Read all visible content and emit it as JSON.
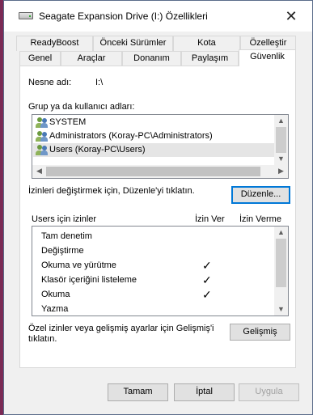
{
  "window": {
    "title": "Seagate Expansion Drive (I:) Özellikleri",
    "close_glyph": "✕"
  },
  "tabs_row1": [
    {
      "label": "ReadyBoost"
    },
    {
      "label": "Önceki Sürümler"
    },
    {
      "label": "Kota"
    },
    {
      "label": "Özelleştir"
    }
  ],
  "tabs_row2": [
    {
      "label": "Genel"
    },
    {
      "label": "Araçlar"
    },
    {
      "label": "Donanım"
    },
    {
      "label": "Paylaşım"
    },
    {
      "label": "Güvenlik"
    }
  ],
  "security": {
    "object_label": "Nesne adı:",
    "object_value": "I:\\",
    "group_label": "Grup ya da kullanıcı adları:",
    "users": [
      {
        "name": "SYSTEM"
      },
      {
        "name": "Administrators (Koray-PC\\Administrators)"
      },
      {
        "name": "Users (Koray-PC\\Users)"
      }
    ],
    "change_hint": "İzinleri değiştirmek için, Düzenle'yi tıklatın.",
    "edit_button": "Düzenle...",
    "perm_header": "Users için izinler",
    "allow_header": "İzin Ver",
    "deny_header": "İzin Verme",
    "permissions": [
      {
        "name": "Tam denetim",
        "allow": ""
      },
      {
        "name": "Değiştirme",
        "allow": ""
      },
      {
        "name": "Okuma ve yürütme",
        "allow": "✓"
      },
      {
        "name": "Klasör içeriğini listeleme",
        "allow": "✓"
      },
      {
        "name": "Okuma",
        "allow": "✓"
      },
      {
        "name": "Yazma",
        "allow": ""
      }
    ],
    "advanced_hint_line1": "Özel izinler veya gelişmiş ayarlar için Gelişmiş'i",
    "advanced_hint_line2": "tıklatın.",
    "advanced_button": "Gelişmiş"
  },
  "footer": {
    "ok": "Tamam",
    "cancel": "İptal",
    "apply": "Uygula"
  },
  "scroll_arrows": {
    "up": "▲",
    "down": "▼",
    "left": "◀",
    "right": "▶"
  }
}
